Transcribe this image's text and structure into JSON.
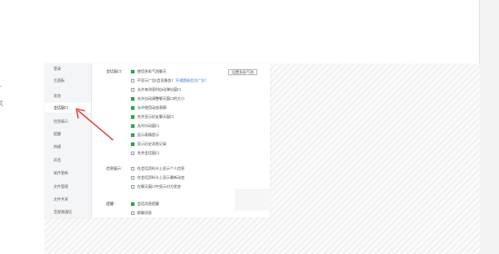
{
  "colors": {
    "checked": "#2ea84a",
    "arrow": "#e23b3b",
    "link": "#3a7bd5"
  },
  "edge_text": [
    "、",
    "ξ"
  ],
  "sidebar": {
    "items": [
      {
        "label": "登录",
        "active": false
      },
      {
        "label": "主面板",
        "active": false
      },
      {
        "label": "状态",
        "active": false
      },
      {
        "label": "会话窗口",
        "active": true
      },
      {
        "label": "信息展示",
        "active": false
      },
      {
        "label": "提醒",
        "active": false
      },
      {
        "label": "热键",
        "active": false
      },
      {
        "label": "声音",
        "active": false
      },
      {
        "label": "软件更新",
        "active": false
      },
      {
        "label": "文件管理",
        "active": false
      },
      {
        "label": "文件共享",
        "active": false
      },
      {
        "label": "音视频通话",
        "active": false
      }
    ]
  },
  "sections": {
    "chat_window_label": "会话窗口：",
    "info_label": "信息展示：",
    "reminder_label": "提醒："
  },
  "set_font_button": "设置多彩气泡",
  "chat_options": [
    {
      "label": "使用多彩气泡聊天",
      "checked": true
    },
    {
      "label": "不显示广告(会员服务)",
      "checked": false,
      "link": "开通超级会员广告？"
    },
    {
      "label": "允许来消息时自动弹出窗口",
      "checked": false
    },
    {
      "label": "允许自动调整聊天窗口的大小",
      "checked": true
    },
    {
      "label": "允许使用动态表情",
      "checked": true
    },
    {
      "label": "合并显示好友聊天窗口",
      "checked": true
    },
    {
      "label": "允许抖动窗口",
      "checked": true
    },
    {
      "label": "显示表情提示",
      "checked": true
    },
    {
      "label": "显示历史消息记录",
      "checked": true
    },
    {
      "label": "合并会话窗口",
      "checked": false
    }
  ],
  "info_options": [
    {
      "label": "在会话资料卡上显示个人信息",
      "checked": false
    },
    {
      "label": "在会话资料卡上显示最新动态",
      "checked": false
    },
    {
      "label": "在聊天窗口中显示对方状态",
      "checked": false
    }
  ],
  "reminder_options": [
    {
      "label": "会话消息提醒",
      "checked": true
    },
    {
      "label": "群聊消息",
      "checked": false
    }
  ]
}
